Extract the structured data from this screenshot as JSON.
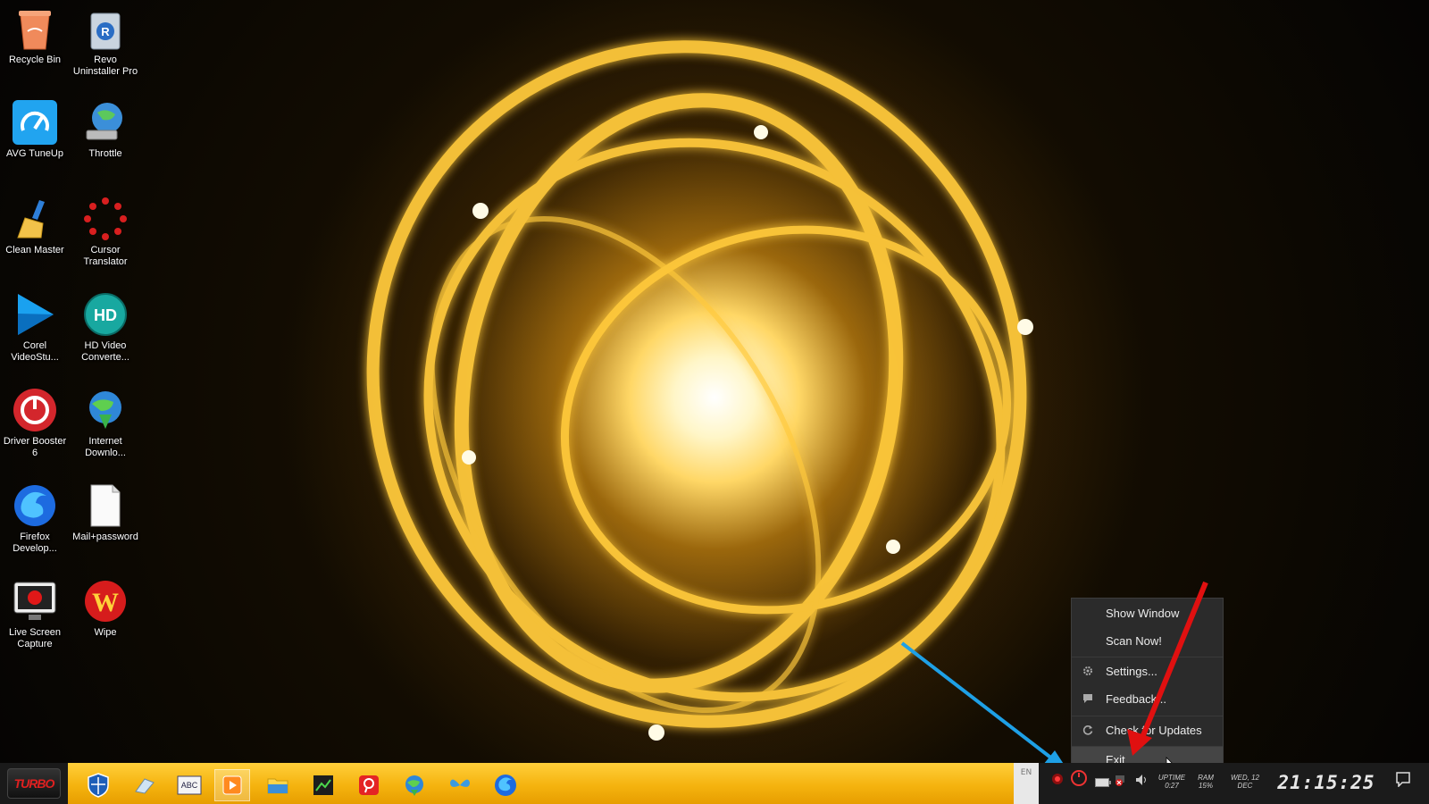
{
  "desktop": {
    "icons": [
      {
        "label": "Recycle Bin",
        "icon": "recycle-bin-icon"
      },
      {
        "label": "Revo Uninstaller Pro",
        "icon": "revo-uninstaller-icon"
      },
      {
        "label": "AVG TuneUp",
        "icon": "avg-tuneup-icon"
      },
      {
        "label": "Throttle",
        "icon": "throttle-icon"
      },
      {
        "label": "Clean Master",
        "icon": "clean-master-icon"
      },
      {
        "label": "Cursor Translator",
        "icon": "cursor-translator-icon"
      },
      {
        "label": "Corel VideoStu...",
        "icon": "corel-videostudio-icon"
      },
      {
        "label": "HD Video Converte...",
        "icon": "hd-video-converter-icon"
      },
      {
        "label": "Driver Booster 6",
        "icon": "driver-booster-icon"
      },
      {
        "label": "Internet Downlo...",
        "icon": "internet-download-manager-icon"
      },
      {
        "label": "Firefox Develop...",
        "icon": "firefox-developer-icon"
      },
      {
        "label": "Mail+password",
        "icon": "text-file-icon"
      },
      {
        "label": "Live Screen Capture",
        "icon": "live-screen-capture-icon"
      },
      {
        "label": "Wipe",
        "icon": "wipe-icon"
      }
    ]
  },
  "context_menu": {
    "items": [
      {
        "label": "Show Window",
        "icon": ""
      },
      {
        "label": "Scan Now!",
        "icon": ""
      },
      {
        "label": "Settings...",
        "icon": "gear-icon"
      },
      {
        "label": "Feedback...",
        "icon": "chat-icon"
      },
      {
        "label": "Check for Updates",
        "icon": "refresh-icon"
      },
      {
        "label": "Exit",
        "icon": ""
      }
    ],
    "hovered": "Exit"
  },
  "taskbar": {
    "start_label": "TURBO",
    "apps": [
      "windows-defender-icon",
      "eraser-icon",
      "abc-spell-icon",
      "media-player-icon",
      "file-explorer-icon",
      "green-grid-app-icon",
      "red-pin-app-icon",
      "internet-download-manager-icon",
      "blue-butterfly-app-icon",
      "firefox-icon"
    ],
    "language": "EN",
    "tray": {
      "uptime_label": "UPTIME",
      "uptime_value": "0:27",
      "ram_label": "RAM",
      "ram_value": "15%",
      "day": "WED, 12",
      "month": "DEC",
      "time": "21:15:25"
    }
  },
  "colors": {
    "taskbar_band": "#f5b30f",
    "menu_bg": "#2b2b2b",
    "arrow_blue": "#1ea0e6",
    "arrow_red": "#e01010"
  }
}
